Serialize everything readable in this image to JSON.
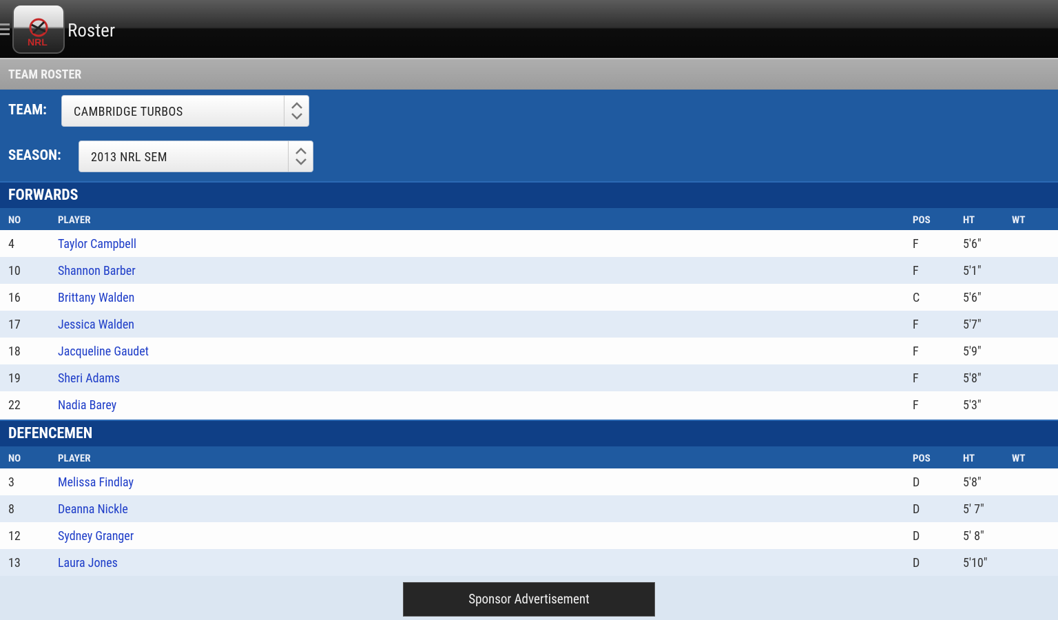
{
  "app": {
    "title": "Roster",
    "logo_icon": "nrl-logo-icon",
    "menu_icon": "hamburger-icon"
  },
  "section_label": "TEAM ROSTER",
  "selectors": {
    "team_label": "TEAM:",
    "team_value": "CAMBRIDGE TURBOS",
    "season_label": "SEASON:",
    "season_value": "2013 NRL SEM"
  },
  "columns": {
    "no": "NO",
    "player": "PLAYER",
    "pos": "POS",
    "ht": "HT",
    "wt": "WT"
  },
  "groups": [
    {
      "title": "FORWARDS",
      "rows": [
        {
          "no": "4",
          "player": "Taylor Campbell",
          "pos": "F",
          "ht": "5'6\"",
          "wt": ""
        },
        {
          "no": "10",
          "player": "Shannon Barber",
          "pos": "F",
          "ht": "5'1\"",
          "wt": ""
        },
        {
          "no": "16",
          "player": "Brittany Walden",
          "pos": "C",
          "ht": "5'6\"",
          "wt": ""
        },
        {
          "no": "17",
          "player": "Jessica Walden",
          "pos": "F",
          "ht": "5'7\"",
          "wt": ""
        },
        {
          "no": "18",
          "player": "Jacqueline Gaudet",
          "pos": "F",
          "ht": "5'9\"",
          "wt": ""
        },
        {
          "no": "19",
          "player": "Sheri Adams",
          "pos": "F",
          "ht": "5'8\"",
          "wt": ""
        },
        {
          "no": "22",
          "player": "Nadia Barey",
          "pos": "F",
          "ht": "5'3\"",
          "wt": ""
        }
      ]
    },
    {
      "title": "DEFENCEMEN",
      "rows": [
        {
          "no": "3",
          "player": "Melissa Findlay",
          "pos": "D",
          "ht": "5'8\"",
          "wt": ""
        },
        {
          "no": "8",
          "player": "Deanna Nickle",
          "pos": "D",
          "ht": "5' 7\"",
          "wt": ""
        },
        {
          "no": "12",
          "player": "Sydney Granger",
          "pos": "D",
          "ht": "5' 8\"",
          "wt": ""
        },
        {
          "no": "13",
          "player": "Laura Jones",
          "pos": "D",
          "ht": "5'10\"",
          "wt": ""
        }
      ]
    }
  ],
  "footer": {
    "sponsor_label": "Sponsor Advertisement"
  },
  "colors": {
    "primary_blue": "#1f5aa0",
    "header_navy": "#0f3f86",
    "link_blue": "#1e3dc8"
  }
}
